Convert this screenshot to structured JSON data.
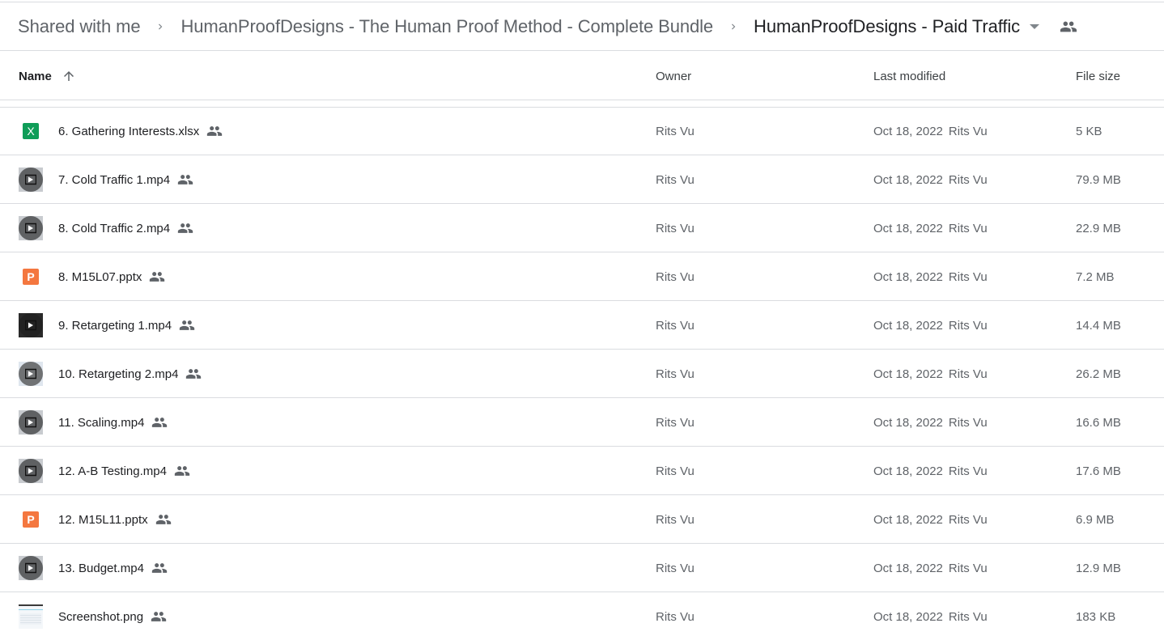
{
  "breadcrumb": {
    "items": [
      {
        "label": "Shared with me"
      },
      {
        "label": "HumanProofDesigns - The Human Proof Method - Complete Bundle"
      },
      {
        "label": "HumanProofDesigns - Paid Traffic"
      }
    ],
    "separator_icon": "chevron-right-icon",
    "dropdown_icon": "caret-down-icon",
    "shared_icon": "people-icon"
  },
  "table": {
    "columns": {
      "name": "Name",
      "owner": "Owner",
      "last_modified": "Last modified",
      "file_size": "File size"
    },
    "sort": {
      "column": "name",
      "direction": "ascending",
      "icon": "arrow-up-icon"
    },
    "rows": [
      {
        "name": "6. Gathering Interests.xlsx",
        "type": "xlsx",
        "type_glyph": "X",
        "shared": true,
        "owner": "Rits Vu",
        "modified_date": "Oct 18, 2022",
        "modified_by": "Rits Vu",
        "size": "5 KB"
      },
      {
        "name": "7. Cold Traffic 1.mp4",
        "type": "video",
        "shared": true,
        "owner": "Rits Vu",
        "modified_date": "Oct 18, 2022",
        "modified_by": "Rits Vu",
        "size": "79.9 MB"
      },
      {
        "name": "8. Cold Traffic 2.mp4",
        "type": "video",
        "shared": true,
        "owner": "Rits Vu",
        "modified_date": "Oct 18, 2022",
        "modified_by": "Rits Vu",
        "size": "22.9 MB"
      },
      {
        "name": "8. M15L07.pptx",
        "type": "pptx",
        "type_glyph": "P",
        "shared": true,
        "owner": "Rits Vu",
        "modified_date": "Oct 18, 2022",
        "modified_by": "Rits Vu",
        "size": "7.2 MB"
      },
      {
        "name": "9. Retargeting 1.mp4",
        "type": "video-dark",
        "shared": true,
        "owner": "Rits Vu",
        "modified_date": "Oct 18, 2022",
        "modified_by": "Rits Vu",
        "size": "14.4 MB"
      },
      {
        "name": "10. Retargeting 2.mp4",
        "type": "video-light",
        "shared": true,
        "owner": "Rits Vu",
        "modified_date": "Oct 18, 2022",
        "modified_by": "Rits Vu",
        "size": "26.2 MB"
      },
      {
        "name": "11. Scaling.mp4",
        "type": "video",
        "shared": true,
        "owner": "Rits Vu",
        "modified_date": "Oct 18, 2022",
        "modified_by": "Rits Vu",
        "size": "16.6 MB"
      },
      {
        "name": "12. A-B Testing.mp4",
        "type": "video",
        "shared": true,
        "owner": "Rits Vu",
        "modified_date": "Oct 18, 2022",
        "modified_by": "Rits Vu",
        "size": "17.6 MB"
      },
      {
        "name": "12. M15L11.pptx",
        "type": "pptx",
        "type_glyph": "P",
        "shared": true,
        "owner": "Rits Vu",
        "modified_date": "Oct 18, 2022",
        "modified_by": "Rits Vu",
        "size": "6.9 MB"
      },
      {
        "name": "13. Budget.mp4",
        "type": "video",
        "shared": true,
        "owner": "Rits Vu",
        "modified_date": "Oct 18, 2022",
        "modified_by": "Rits Vu",
        "size": "12.9 MB"
      },
      {
        "name": "Screenshot.png",
        "type": "image",
        "shared": true,
        "owner": "Rits Vu",
        "modified_date": "Oct 18, 2022",
        "modified_by": "Rits Vu",
        "size": "183 KB"
      }
    ]
  },
  "colors": {
    "xlsx": "#0f9d58",
    "pptx": "#f4773f",
    "divider": "#dadce0",
    "text_primary": "#202124",
    "text_secondary": "#5f6368"
  }
}
